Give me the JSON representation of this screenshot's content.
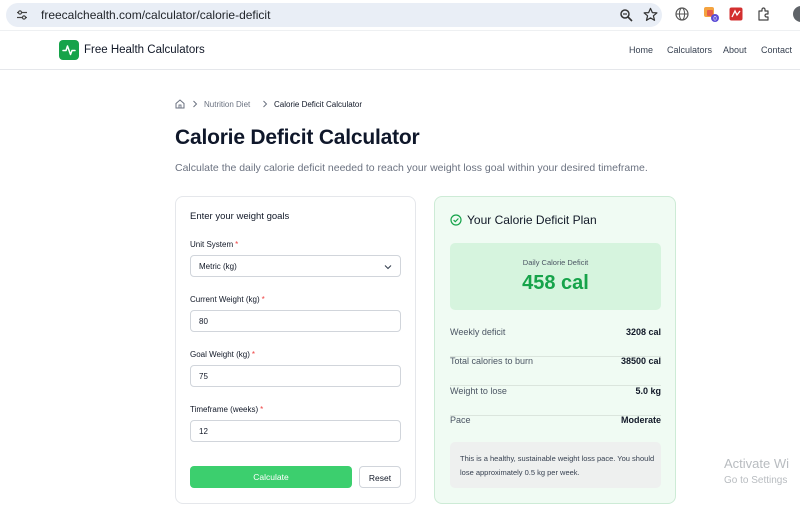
{
  "browser": {
    "url": "freecalchealth.com/calculator/calorie-deficit",
    "extension_badge": "0"
  },
  "header": {
    "brand": "Free Health Calculators",
    "nav": [
      "Home",
      "Calculators",
      "About",
      "Contact"
    ]
  },
  "breadcrumb": {
    "items": [
      "Nutrition Diet",
      "Calorie Deficit Calculator"
    ]
  },
  "page": {
    "title": "Calorie Deficit Calculator",
    "subtitle": "Calculate the daily calorie deficit needed to reach your weight loss goal within your desired timeframe."
  },
  "form": {
    "heading": "Enter your weight goals",
    "required_mark": "*",
    "fields": [
      {
        "label": "Unit System",
        "value": "Metric (kg)"
      },
      {
        "label": "Current Weight (kg)",
        "value": "80"
      },
      {
        "label": "Goal Weight (kg)",
        "value": "75"
      },
      {
        "label": "Timeframe (weeks)",
        "value": "12"
      }
    ],
    "calculate_label": "Calculate",
    "reset_label": "Reset"
  },
  "results": {
    "heading": "Your Calorie Deficit Plan",
    "daily_label": "Daily Calorie Deficit",
    "daily_value": "458 cal",
    "stats": [
      {
        "label": "Weekly deficit",
        "value": "3208 cal"
      },
      {
        "label": "Total calories to burn",
        "value": "38500 cal"
      },
      {
        "label": "Weight to lose",
        "value": "5.0 kg"
      },
      {
        "label": "Pace",
        "value": "Moderate"
      }
    ],
    "note": "This is a healthy, sustainable weight loss pace. You should lose approximately 0.5 kg per week."
  },
  "watermark": {
    "title": "Activate Wi",
    "subtitle": "Go to Settings"
  },
  "colors": {
    "brand_green": "#16a34a",
    "button_green": "#3ccf6e",
    "result_bg": "#f0fbf3",
    "highlight_bg": "#d6f4de",
    "required_red": "#ef4444"
  },
  "icons": {
    "site_info": "tune-icon",
    "zoom": "zoom-icon",
    "bookmark": "star-icon",
    "home": "home-icon",
    "result": "check-circle-icon",
    "select": "chevron-down-icon"
  }
}
